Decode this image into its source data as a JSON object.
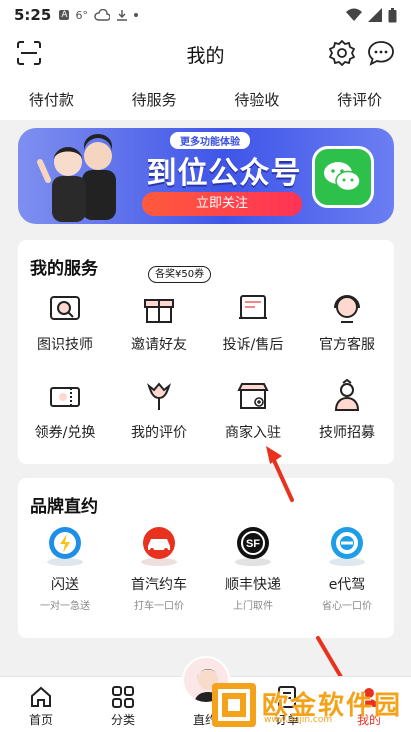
{
  "status": {
    "time": "5:25",
    "icons": [
      "A",
      "6°"
    ]
  },
  "header": {
    "title": "我的"
  },
  "orders": [
    "待付款",
    "待服务",
    "待验收",
    "待评价"
  ],
  "banner": {
    "tag": "更多功能体验",
    "title": "到位公众号",
    "button": "立即关注"
  },
  "services": {
    "title": "我的服务",
    "badge": "各奖¥50券",
    "row1": [
      {
        "label": "图识技师",
        "icon": "photo-search-icon"
      },
      {
        "label": "邀请好友",
        "icon": "gift-icon"
      },
      {
        "label": "投诉/售后",
        "icon": "complaint-icon"
      },
      {
        "label": "官方客服",
        "icon": "customer-service-icon"
      }
    ],
    "row2": [
      {
        "label": "领券/兑换",
        "icon": "coupon-icon"
      },
      {
        "label": "我的评价",
        "icon": "tulip-icon"
      },
      {
        "label": "商家入驻",
        "icon": "storefront-icon"
      },
      {
        "label": "技师招募",
        "icon": "technician-icon"
      }
    ]
  },
  "brands": {
    "title": "品牌直约",
    "items": [
      {
        "label": "闪送",
        "sub": "一对一急送",
        "icon": "shansong-icon",
        "color": "#1e8fe8"
      },
      {
        "label": "首汽约车",
        "sub": "打车一口价",
        "icon": "car-icon",
        "color": "#e8321e"
      },
      {
        "label": "顺丰快递",
        "sub": "上门取件",
        "icon": "sf-express-icon",
        "color": "#111111"
      },
      {
        "label": "e代驾",
        "sub": "省心一口价",
        "icon": "edaijia-icon",
        "color": "#1e9ee8"
      }
    ]
  },
  "tabbar": [
    {
      "label": "首页",
      "icon": "home-icon"
    },
    {
      "label": "分类",
      "icon": "grid-icon"
    },
    {
      "label": "直约",
      "icon": "avatar"
    },
    {
      "label": "订单",
      "icon": "order-icon"
    },
    {
      "label": "我的",
      "icon": "profile-icon"
    }
  ],
  "watermark": {
    "text": "欧金软件园",
    "url": "www.oujin.com"
  },
  "colors": {
    "accent": "#e8321e",
    "annotation_arrow": "#e8321e",
    "wechat": "#2dc14b"
  }
}
